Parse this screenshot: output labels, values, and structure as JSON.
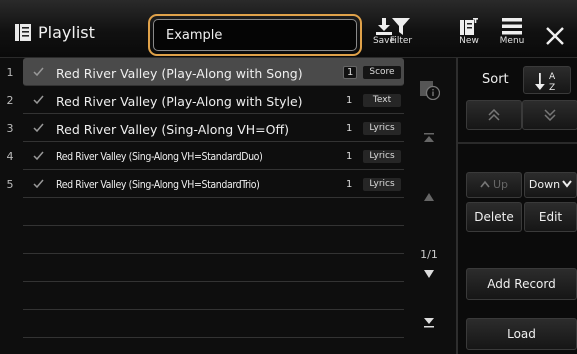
{
  "header": {
    "title": "Playlist",
    "playlist_name": "Example",
    "tools": [
      {
        "label": "Save",
        "icon": "download-icon"
      },
      {
        "label": "Filter",
        "icon": "filter-icon"
      },
      {
        "label": "New",
        "icon": "new-document-icon"
      },
      {
        "label": "Menu",
        "icon": "hamburger-menu-icon"
      }
    ]
  },
  "list": {
    "records": [
      {
        "number": "1",
        "title": "Red River Valley (Play-Along with Song)",
        "count": "1",
        "tag": "Score",
        "selected": true
      },
      {
        "number": "2",
        "title": "Red River Valley (Play-Along with Style)",
        "count": "1",
        "tag": "Text",
        "selected": false
      },
      {
        "number": "3",
        "title": "Red River Valley (Sing-Along VH=Off)",
        "count": "1",
        "tag": "Lyrics",
        "selected": false
      },
      {
        "number": "4",
        "title": "Red River Valley (Sing-Along VH=StandardDuo)",
        "count": "1",
        "tag": "Lyrics",
        "selected": false
      },
      {
        "number": "5",
        "title": "Red River Valley (Sing-Along VH=StandardTrio)",
        "count": "1",
        "tag": "Lyrics",
        "selected": false
      }
    ],
    "page_indicator": "1/1"
  },
  "panel": {
    "sort_label": "Sort",
    "sort_icon_text": "A Z",
    "up_label": "Up",
    "down_label": "Down",
    "delete_label": "Delete",
    "edit_label": "Edit",
    "add_record_label": "Add Record",
    "load_label": "Load"
  },
  "colors": {
    "accent": "#e0a24a",
    "background": "#0e0e0e",
    "selected_row": "#4a4a4a"
  }
}
